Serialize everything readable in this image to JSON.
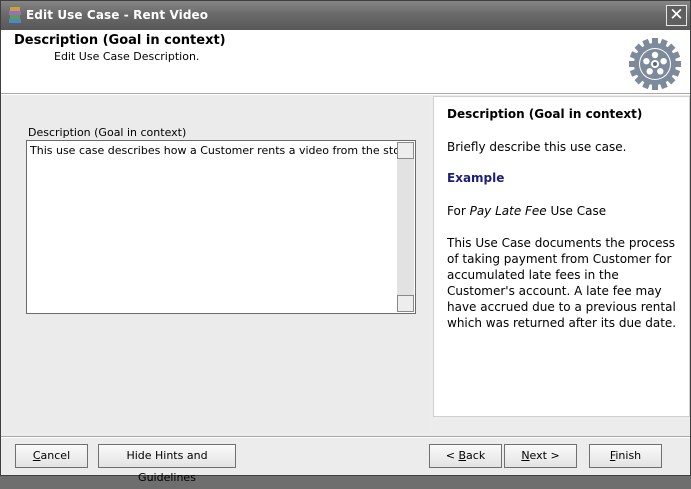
{
  "window": {
    "title": "Edit Use Case - Rent Video",
    "close_glyph": "✕"
  },
  "header": {
    "title": "Description (Goal in context)",
    "subtitle": "Edit Use Case Description."
  },
  "form": {
    "field_label": "Description (Goal in context)",
    "value": "This use case describes how a Customer rents a video from the store."
  },
  "hints": {
    "heading": "Description (Goal in context)",
    "intro": "Briefly describe this use case.",
    "example_heading": "Example",
    "example_prefix": "For ",
    "example_name": "Pay Late Fee",
    "example_suffix": " Use Case",
    "example_body": "This Use Case documents the process of taking payment from Customer for accumulated late fees in the Customer's account. A late fee may have accrued due to a previous rental which was returned after its due date."
  },
  "buttons": {
    "cancel_prefix": "",
    "cancel_key": "C",
    "cancel_rest": "ancel",
    "hide_hints": "Hide Hints and Guidelines",
    "back_arrow": "< ",
    "back_key": "B",
    "back_rest": "ack",
    "next_key": "N",
    "next_rest": "ext",
    "next_arrow": " >",
    "finish_key": "F",
    "finish_rest": "inish"
  },
  "colors": {
    "titlebar": "#6a6a6a",
    "example_heading": "#1e1e7a"
  }
}
